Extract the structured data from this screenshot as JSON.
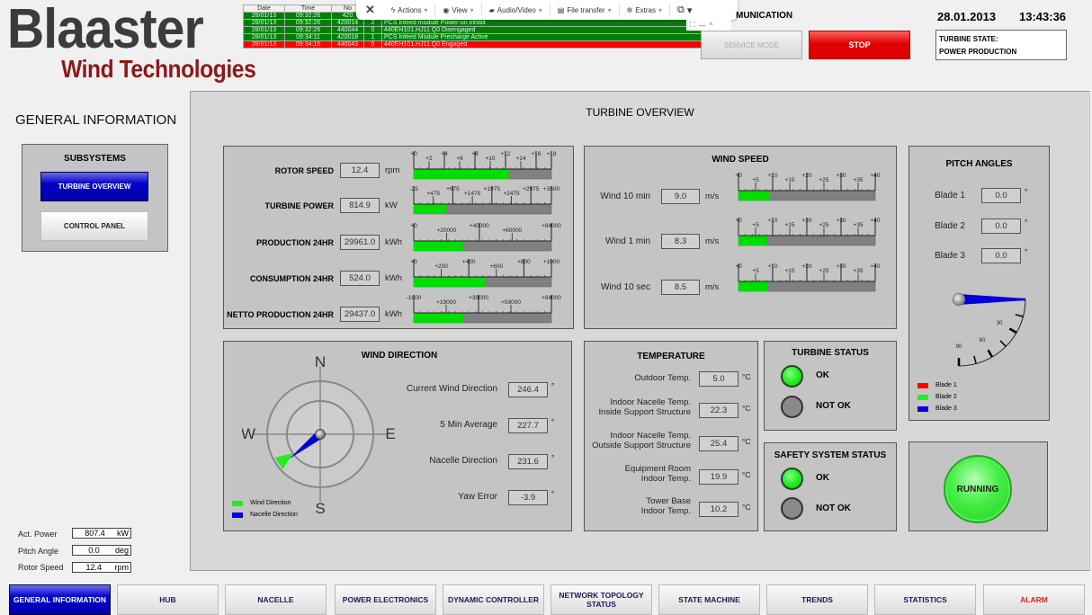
{
  "logo": {
    "line1": "Blaaster",
    "line2": "Wind Technologies"
  },
  "alarm_table": {
    "headers": [
      "Date",
      "Time",
      "No",
      "",
      ""
    ],
    "rows": [
      {
        "date": "28/01/13",
        "time": "09:32:26",
        "no": "420",
        "code": "",
        "msg": "",
        "status": "ok"
      },
      {
        "date": "28/01/13",
        "time": "09:32:26",
        "no": "420014",
        "code": "2",
        "msg": "PCS Infeed module Power-on inhibit",
        "status": "ok"
      },
      {
        "date": "28/01/13",
        "time": "09:32:26",
        "no": "440044",
        "code": "0",
        "msg": "440EH101.HJ11 Q0 Disengaged",
        "status": "ok"
      },
      {
        "date": "28/01/13",
        "time": "09:34:11",
        "no": "420018",
        "code": "1",
        "msg": "PCS Infeed Module Precharge Active",
        "status": "ok"
      },
      {
        "date": "28/01/13",
        "time": "09:34:18",
        "no": "440043",
        "code": "0",
        "msg": "440EH101.HJ11 Q0 Engaged",
        "status": "alarm"
      }
    ]
  },
  "teamviewer_toolbar": {
    "close": "✕",
    "items": [
      {
        "icon": "lightning-icon",
        "glyph": "ϟ",
        "label": "Actions"
      },
      {
        "icon": "eye-icon",
        "glyph": "◉",
        "label": "View"
      },
      {
        "icon": "chat-icon",
        "glyph": "▰",
        "label": "Audio/Video"
      },
      {
        "icon": "file-icon",
        "glyph": "▤",
        "label": "File transfer"
      },
      {
        "icon": "puzzle-icon",
        "glyph": "✲",
        "label": "Extras"
      }
    ],
    "window_glyph": "⧉",
    "mini": [
      "⛶",
      "—",
      "^"
    ]
  },
  "header": {
    "communication": "MUNICATION",
    "service_mode": "SERVICE MODE",
    "stop": "STOP",
    "date": "28.01.2013",
    "time": "13:43:36",
    "turbine_state_label": "TURBINE STATE:",
    "turbine_state_value": "POWER PRODUCTION"
  },
  "sidebar": {
    "title": "GENERAL INFORMATION",
    "subsystems_title": "SUBSYSTEMS",
    "buttons": [
      "TURBINE OVERVIEW",
      "CONTROL PANEL"
    ],
    "summary": [
      {
        "label": "Act. Power",
        "value": "807.4",
        "unit": "kW"
      },
      {
        "label": "Pitch Angle",
        "value": "0.0",
        "unit": "deg"
      },
      {
        "label": "Rotor Speed",
        "value": "12.4",
        "unit": "rpm"
      }
    ]
  },
  "overview": {
    "title": "TURBINE OVERVIEW",
    "production": [
      {
        "label": "ROTOR SPEED",
        "value": "12.4",
        "unit": "rpm",
        "min": 0,
        "max": 18,
        "fill": 12.4,
        "major": [
          "+0",
          "+4",
          "+8",
          "+12",
          "+16",
          "+18"
        ],
        "minor": [
          "+2",
          "+6",
          "+10",
          "+14"
        ]
      },
      {
        "label": "TURBINE POWER",
        "value": "814.9",
        "unit": "kW",
        "min": -25,
        "max": 3500,
        "fill": 814.9,
        "major": [
          "-25",
          "+975",
          "+1975",
          "+2975",
          "+3500"
        ],
        "minor": [
          "+475",
          "+1475",
          "+2475"
        ]
      },
      {
        "label": "PRODUCTION 24HR",
        "value": "29961.0",
        "unit": "kWh",
        "min": 0,
        "max": 84000,
        "fill": 29961,
        "major": [
          "+0",
          "+40000",
          "+84000"
        ],
        "minor": [
          "+20000",
          "+60000"
        ]
      },
      {
        "label": "CONSUMPTION 24HR",
        "value": "524.0",
        "unit": "kWh",
        "min": 0,
        "max": 1000,
        "fill": 524,
        "major": [
          "+0",
          "+400",
          "+800",
          "+1000"
        ],
        "minor": [
          "+200",
          "+600"
        ]
      },
      {
        "label": "NETTO PRODUCTION 24HR",
        "value": "29437.0",
        "unit": "kWh",
        "min": -1000,
        "max": 84000,
        "fill": 29437,
        "major": [
          "-1000",
          "+39000",
          "+84000"
        ],
        "minor": [
          "+19000",
          "+59000"
        ]
      }
    ],
    "wind_speed": {
      "title": "WIND SPEED",
      "rows": [
        {
          "label": "Wind 10 min",
          "value": "9.0",
          "unit": "m/s",
          "fill": 9.0
        },
        {
          "label": "Wind 1 min",
          "value": "8.3",
          "unit": "m/s",
          "fill": 8.3
        },
        {
          "label": "Wind 10 sec",
          "value": "8.5",
          "unit": "m/s",
          "fill": 8.5
        }
      ],
      "min": 0,
      "max": 40,
      "major": [
        "+0",
        "+10",
        "+20",
        "+30",
        "+40"
      ],
      "minor": [
        "+5",
        "+15",
        "+25",
        "+35"
      ]
    },
    "pitch": {
      "title": "PITCH ANGLES",
      "blades": [
        {
          "label": "Blade 1",
          "value": "0.0"
        },
        {
          "label": "Blade 2",
          "value": "0.0"
        },
        {
          "label": "Blade 3",
          "value": "0.0"
        }
      ],
      "dial_labels": [
        "30",
        "60",
        "90"
      ],
      "legend": [
        {
          "label": "Blade 1",
          "color": "#ff0000"
        },
        {
          "label": "Blade 2",
          "color": "#22ee22"
        },
        {
          "label": "Blade 3",
          "color": "#0000dd"
        }
      ]
    },
    "wind_direction": {
      "title": "WIND DIRECTION",
      "compass": [
        "N",
        "E",
        "S",
        "W"
      ],
      "rows": [
        {
          "label": "Current Wind Direction",
          "value": "246.4"
        },
        {
          "label": "5 Min Average",
          "value": "227.7"
        },
        {
          "label": "Nacelle Direction",
          "value": "231.6"
        },
        {
          "label": "Yaw Error",
          "value": "-3.9"
        }
      ],
      "wind_deg": 235,
      "nacelle_deg": 231.6,
      "legend": [
        {
          "label": "Wind Direction",
          "color": "#22ee22"
        },
        {
          "label": "Nacelle Direction",
          "color": "#0000dd"
        }
      ]
    },
    "temperature": {
      "title": "TEMPERATURE",
      "unit": "°C",
      "rows": [
        {
          "label1": "",
          "label2": "Outdoor Temp.",
          "value": "5.0"
        },
        {
          "label1": "Indoor Nacelle Temp.",
          "label2": "Inside Support Structure",
          "value": "22.3"
        },
        {
          "label1": "Indoor Nacelle Temp.",
          "label2": "Outside Support Structure",
          "value": "25.4"
        },
        {
          "label1": "Equipment Room",
          "label2": "Indoor Temp.",
          "value": "19.9"
        },
        {
          "label1": "Tower Base",
          "label2": "Indoor Temp.",
          "value": "10.2"
        }
      ]
    },
    "turbine_status": {
      "title": "TURBINE STATUS",
      "ok": "OK",
      "not_ok": "NOT OK",
      "state": "ok"
    },
    "safety_status": {
      "title": "SAFETY SYSTEM STATUS",
      "ok": "OK",
      "not_ok": "NOT OK",
      "state": "ok"
    },
    "running": "RUNNING",
    "colors": {
      "fill": "#00dd00",
      "track": "#808080"
    }
  },
  "bottom_tabs": [
    {
      "label": "GENERAL INFORMATION",
      "active": true
    },
    {
      "label": "HUB"
    },
    {
      "label": "NACELLE"
    },
    {
      "label": "POWER ELECTRONICS"
    },
    {
      "label": "DYNAMIC CONTROLLER"
    },
    {
      "label": "NETWORK TOPOLOGY STATUS"
    },
    {
      "label": "STATE MACHINE"
    },
    {
      "label": "TRENDS"
    },
    {
      "label": "STATISTICS"
    },
    {
      "label": "ALARM",
      "alarm": true
    }
  ]
}
